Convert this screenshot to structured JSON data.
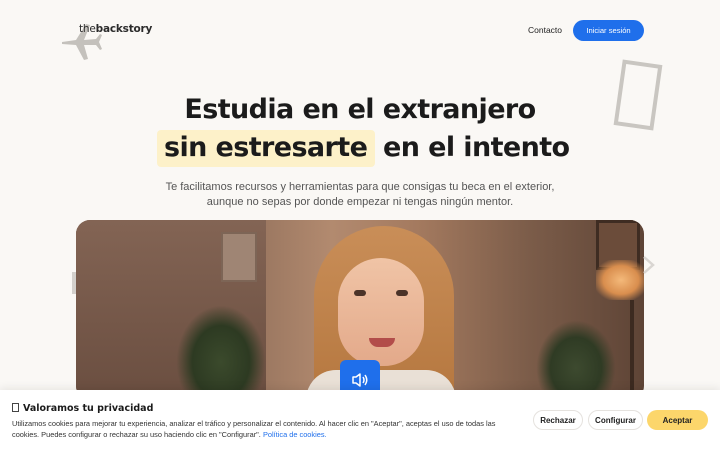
{
  "nav": {
    "logo_prefix": "the",
    "logo_suffix": "backstory",
    "contact_label": "Contacto",
    "login_label": "Iniciar sesión"
  },
  "hero": {
    "title_line1": "Estudia en el extranjero",
    "title_highlight": "sin estresarte",
    "title_rest": "en el intento",
    "subtitle_line1": "Te facilitamos recursos y herramientas para que consigas tu beca en el exterior,",
    "subtitle_line2": "aunque no sepas por donde empezar ni tengas ningún mentor."
  },
  "video": {
    "sound_icon": "speaker-icon"
  },
  "cookie": {
    "title": "Valoramos tu privacidad",
    "text": "Utilizamos cookies para mejorar tu experiencia, analizar el tráfico y personalizar el contenido. Al hacer clic en \"Aceptar\", aceptas el uso de todas las cookies. Puedes configurar o rechazar su uso haciendo clic en \"Configurar\".",
    "link_label": "Política de cookies.",
    "reject_label": "Rechazar",
    "configure_label": "Configurar",
    "accept_label": "Aceptar"
  },
  "colors": {
    "accent": "#1f6feb",
    "highlight": "#fdf1c9",
    "accept": "#fcd66b"
  }
}
